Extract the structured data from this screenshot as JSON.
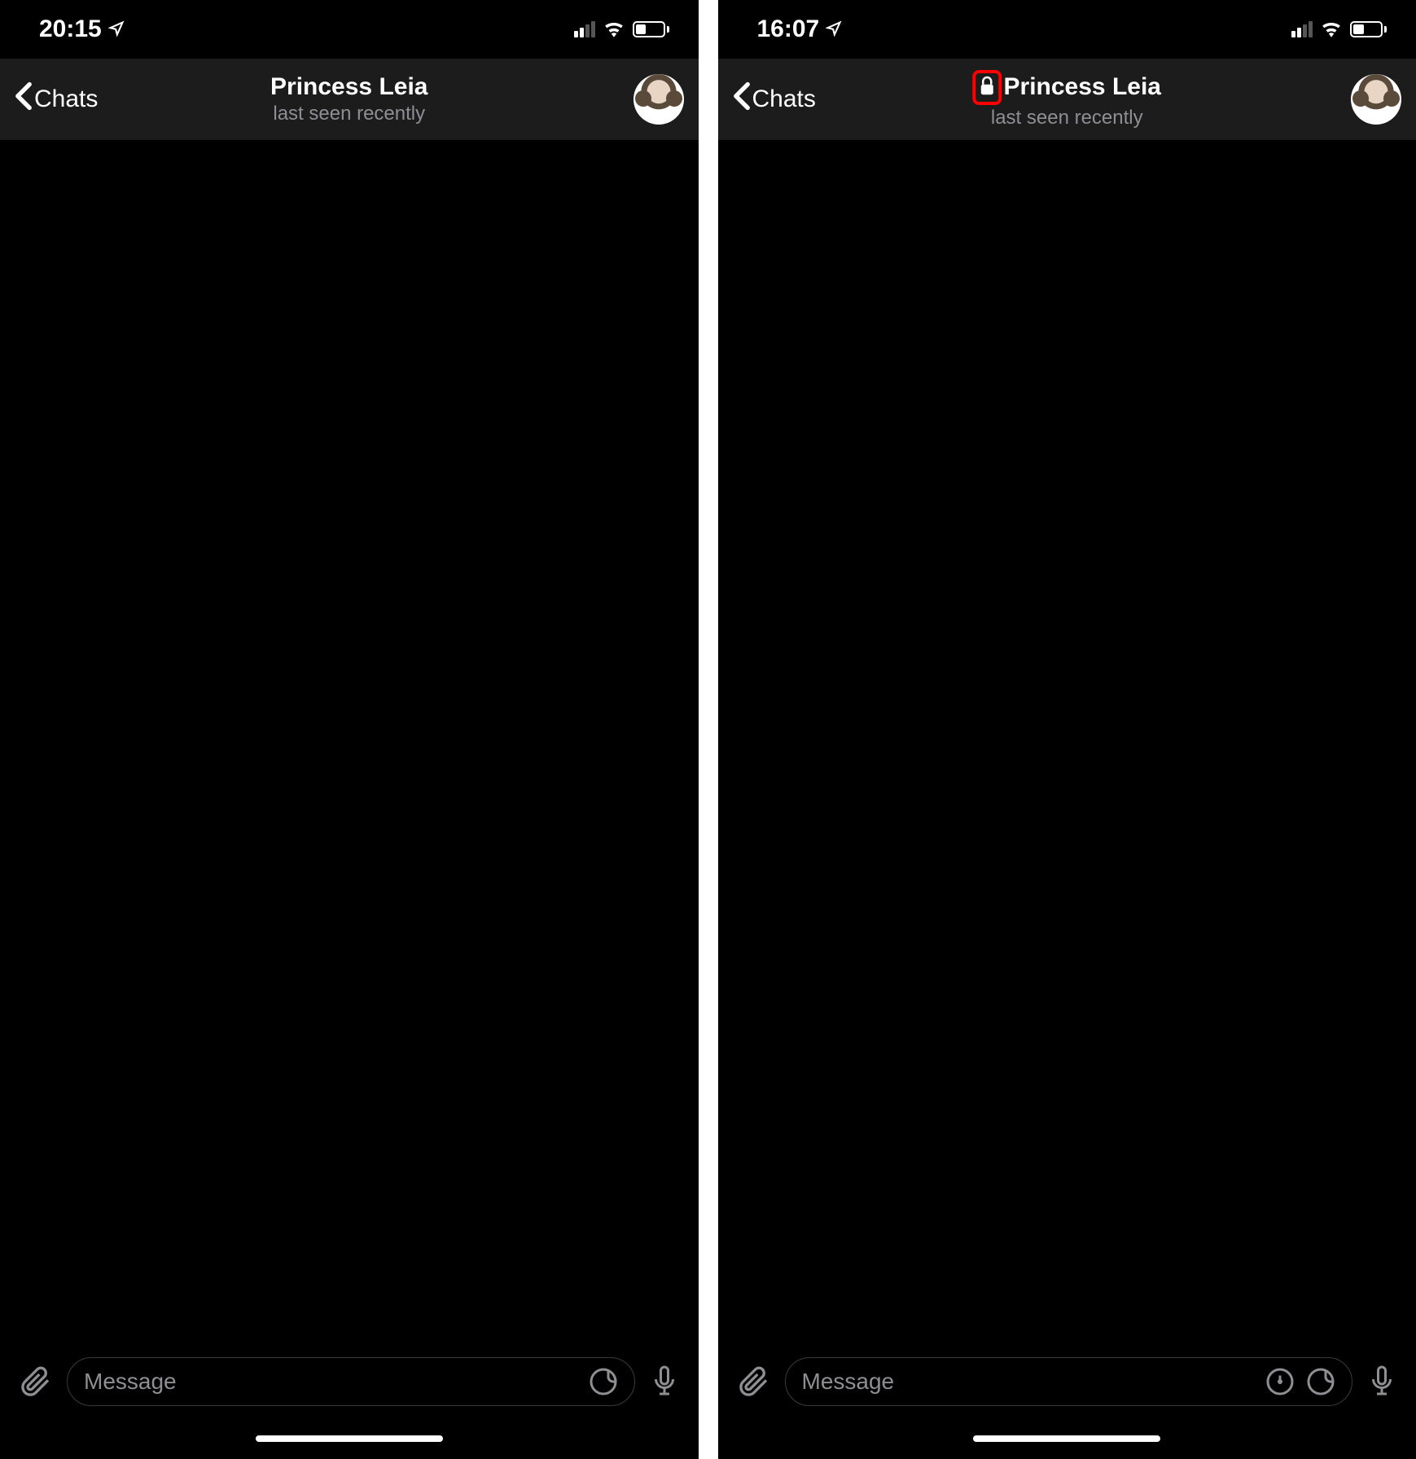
{
  "screens": {
    "left": {
      "status_bar": {
        "time": "20:15",
        "location_active": true,
        "signal_strength": 2,
        "wifi_active": true,
        "battery_level": 40
      },
      "header": {
        "back_label": "Chats",
        "contact_name": "Princess Leia",
        "contact_status": "last seen recently",
        "has_lock": false
      },
      "input": {
        "placeholder": "Message",
        "has_timer": false,
        "has_sticker": true
      }
    },
    "right": {
      "status_bar": {
        "time": "16:07",
        "location_active": true,
        "signal_strength": 2,
        "wifi_active": true,
        "battery_level": 40
      },
      "header": {
        "back_label": "Chats",
        "contact_name": "Princess Leia",
        "contact_status": "last seen recently",
        "has_lock": true
      },
      "input": {
        "placeholder": "Message",
        "has_timer": true,
        "has_sticker": true
      }
    }
  }
}
